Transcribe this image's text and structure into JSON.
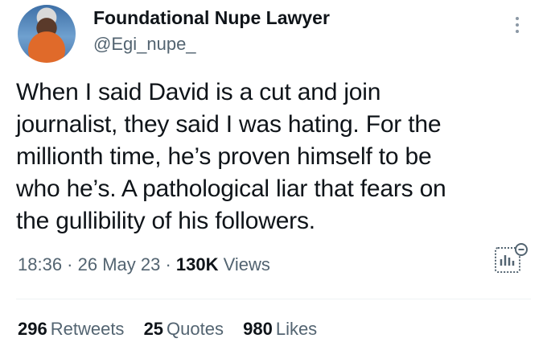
{
  "author": {
    "display_name": "Foundational Nupe Lawyer",
    "handle": "@Egi_nupe_"
  },
  "tweet": {
    "text": "When I said David is a cut and join\njournalist, they said I was hating. For the\nmillionth time, he’s proven himself to be\nwho he’s. A pathological liar that fears on\nthe gullibility of his followers."
  },
  "meta": {
    "time": "18:36",
    "separator": " · ",
    "date": "26 May 23",
    "views_count": "130K",
    "views_label": "Views"
  },
  "stats": {
    "retweets_count": "296",
    "retweets_label": "Retweets",
    "quotes_count": "25",
    "quotes_label": "Quotes",
    "likes_count": "980",
    "likes_label": "Likes"
  },
  "icons": {
    "more": "more-options-icon",
    "analytics": "analytics-icon"
  },
  "colors": {
    "primary_text": "#0f1419",
    "secondary_text": "#536471",
    "divider": "#eff3f4"
  }
}
